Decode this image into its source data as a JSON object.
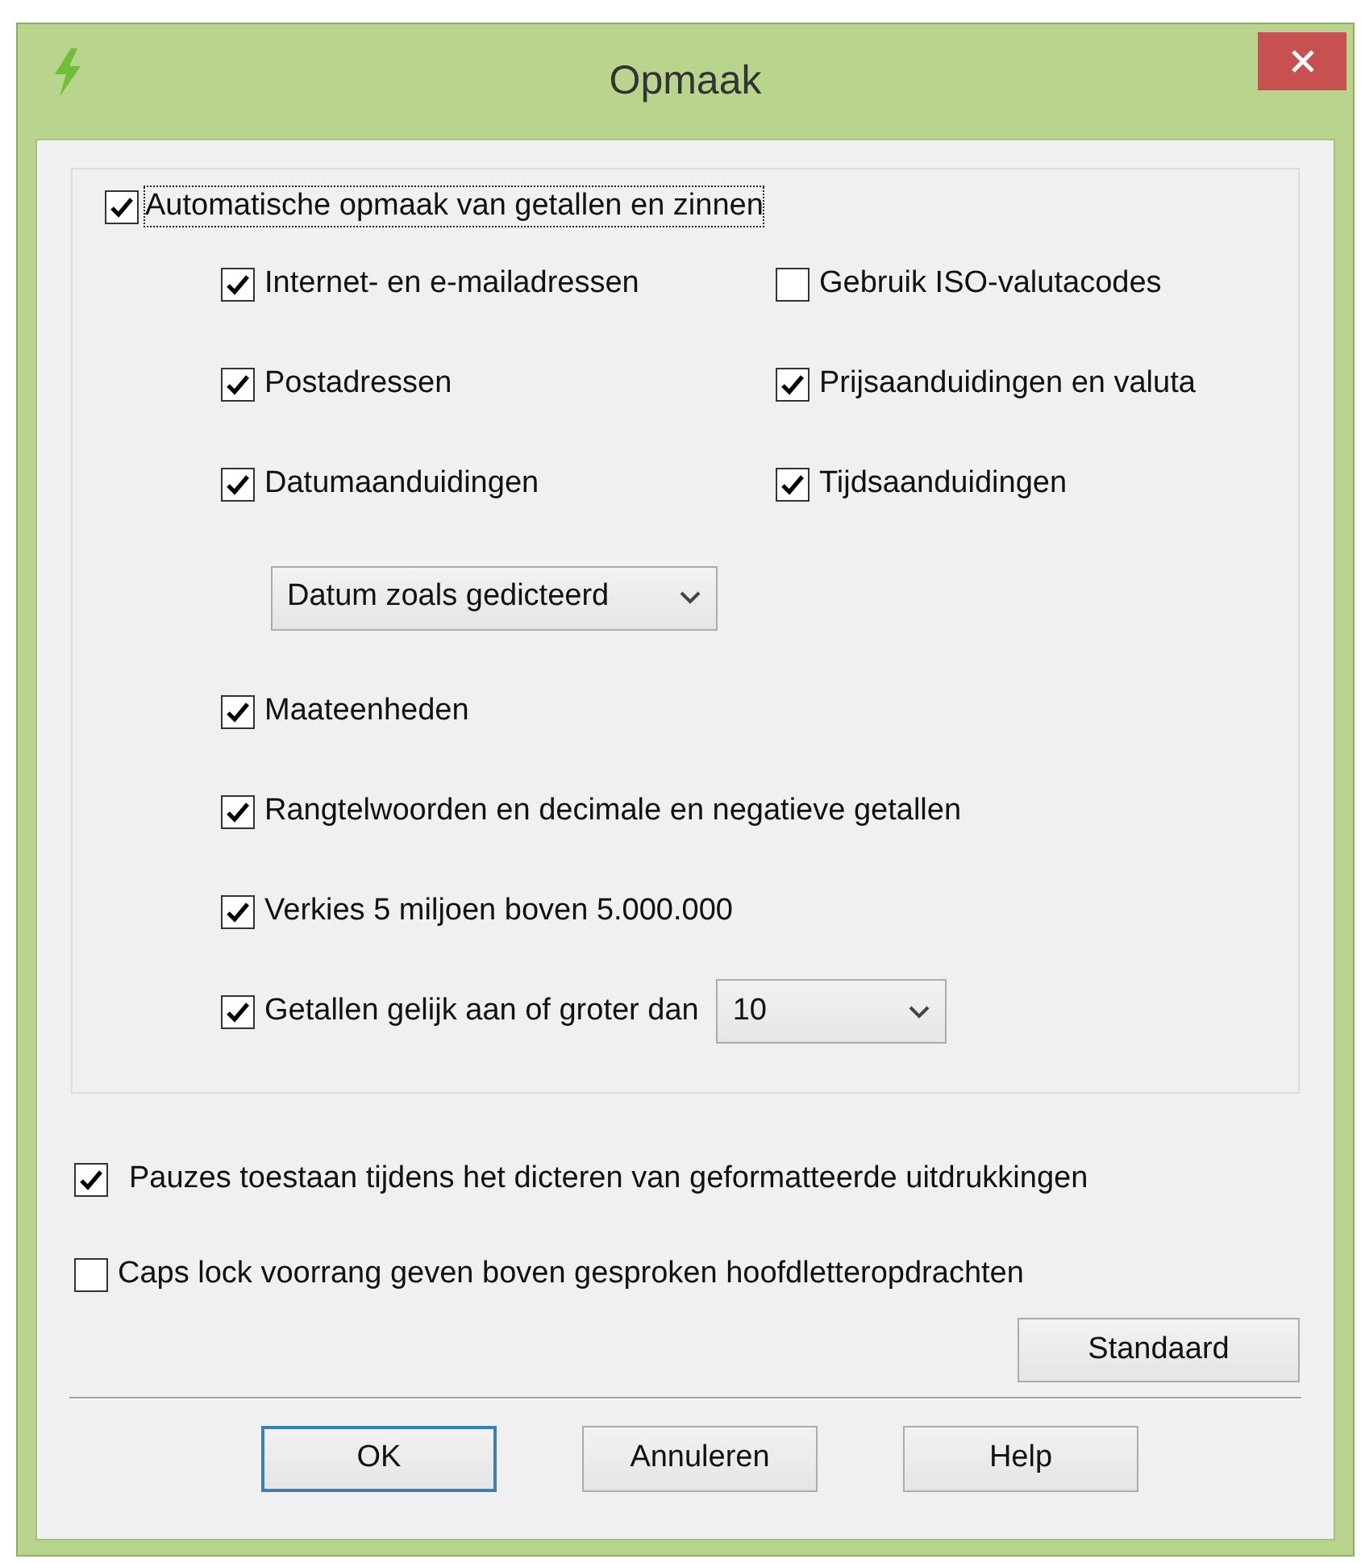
{
  "window": {
    "title": "Opmaak"
  },
  "group": {
    "master": {
      "label": "Automatische opmaak van getallen en zinnen",
      "checked": true,
      "focused": true
    },
    "rows": [
      {
        "kind": "pair",
        "left": {
          "label": "Internet- en e-mailadressen",
          "checked": true
        },
        "right": {
          "label": "Gebruik ISO-valutacodes",
          "checked": false
        }
      },
      {
        "kind": "pair",
        "left": {
          "label": "Postadressen",
          "checked": true
        },
        "right": {
          "label": "Prijsaanduidingen en valuta",
          "checked": true
        }
      },
      {
        "kind": "pair",
        "left": {
          "label": "Datumaanduidingen",
          "checked": true
        },
        "right": {
          "label": "Tijdsaanduidingen",
          "checked": true
        }
      },
      {
        "kind": "dropdown",
        "value": "Datum zoals gedicteerd"
      },
      {
        "kind": "check",
        "label": "Maateenheden",
        "checked": true
      },
      {
        "kind": "check",
        "label": "Rangtelwoorden en decimale en negatieve getallen",
        "checked": true
      },
      {
        "kind": "check",
        "label": "Verkies 5 miljoen boven 5.000.000",
        "checked": true
      },
      {
        "kind": "check_dropdown",
        "label": "Getallen gelijk aan of groter dan",
        "checked": true,
        "value": "10"
      }
    ]
  },
  "options": [
    {
      "label": "Pauzes toestaan tijdens het dicteren van geformatteerde uitdrukkingen",
      "checked": true
    },
    {
      "label": "Caps lock voorrang geven boven gesproken hoofdletteropdrachten",
      "checked": false
    }
  ],
  "reset_button": {
    "label": "Standaard"
  },
  "buttons": [
    {
      "label": "OK",
      "default": true
    },
    {
      "label": "Annuleren",
      "default": false
    },
    {
      "label": "Help",
      "default": false
    }
  ]
}
